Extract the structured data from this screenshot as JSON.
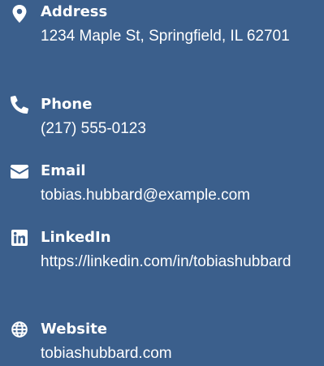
{
  "contacts": [
    {
      "id": "address",
      "icon": "map-pin-icon",
      "label": "Address",
      "value": "1234 Maple St, Springfield, IL 62701"
    },
    {
      "id": "phone",
      "icon": "phone-icon",
      "label": "Phone",
      "value": "(217) 555-0123"
    },
    {
      "id": "email",
      "icon": "envelope-icon",
      "label": "Email",
      "value": "tobias.hubbard@example.com"
    },
    {
      "id": "linkedin",
      "icon": "linkedin-icon",
      "label": "LinkedIn",
      "value": "https://linkedin.com/in/tobiashubbard"
    },
    {
      "id": "website",
      "icon": "globe-icon",
      "label": "Website",
      "value": "tobiashubbard.com"
    }
  ],
  "colors": {
    "background": "#3b5f8c",
    "text": "#ffffff"
  }
}
